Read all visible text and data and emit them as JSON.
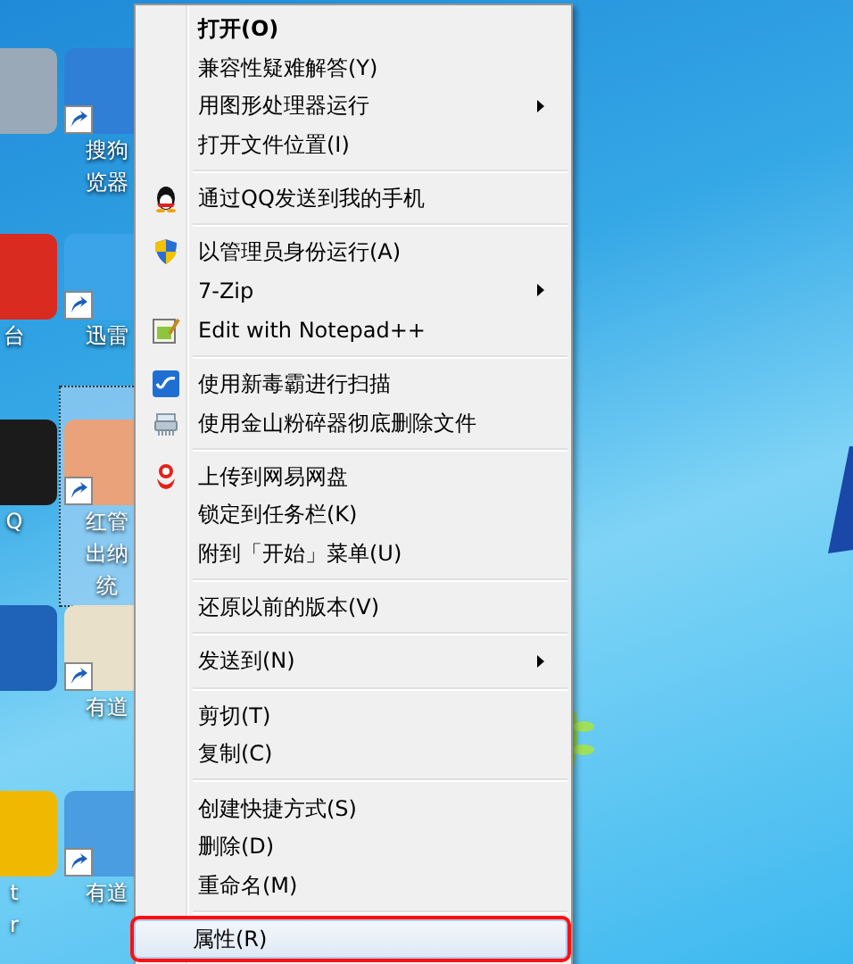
{
  "desktop": {
    "icons": [
      {
        "selected": false
      },
      {
        "lines": [
          "搜狗",
          "览器"
        ],
        "selected": false
      },
      {
        "lines": [
          "台"
        ],
        "selected": false
      },
      {
        "lines": [
          "迅雷"
        ],
        "selected": false
      },
      {
        "lines": [
          "Q"
        ],
        "selected": false
      },
      {
        "lines": [
          "红管",
          "出纳",
          "统"
        ],
        "selected": true
      },
      {
        "selected": false
      },
      {
        "lines": [
          "有道"
        ],
        "selected": false
      },
      {
        "lines": [
          "t",
          "r"
        ],
        "selected": false
      },
      {
        "lines": [
          "有道"
        ],
        "selected": false
      }
    ]
  },
  "context_menu": {
    "items": [
      {
        "kind": "item",
        "label": "打开(O)",
        "default": true,
        "submenu": false,
        "selected": false
      },
      {
        "kind": "item",
        "label": "兼容性疑难解答(Y)",
        "default": false,
        "submenu": false,
        "selected": false
      },
      {
        "kind": "item",
        "label": "用图形处理器运行",
        "default": false,
        "submenu": true,
        "selected": false
      },
      {
        "kind": "item",
        "label": "打开文件位置(I)",
        "default": false,
        "submenu": false,
        "selected": false
      },
      {
        "kind": "separator"
      },
      {
        "kind": "item",
        "label": "通过QQ发送到我的手机",
        "default": false,
        "submenu": false,
        "selected": false
      },
      {
        "kind": "separator"
      },
      {
        "kind": "item",
        "label": "以管理员身份运行(A)",
        "default": false,
        "submenu": false,
        "selected": false
      },
      {
        "kind": "item",
        "label": "7-Zip",
        "default": false,
        "submenu": true,
        "selected": false
      },
      {
        "kind": "item",
        "label": "Edit with Notepad++",
        "default": false,
        "submenu": false,
        "selected": false
      },
      {
        "kind": "separator"
      },
      {
        "kind": "item",
        "label": "使用新毒霸进行扫描",
        "default": false,
        "submenu": false,
        "selected": false
      },
      {
        "kind": "item",
        "label": "使用金山粉碎器彻底删除文件",
        "default": false,
        "submenu": false,
        "selected": false
      },
      {
        "kind": "separator"
      },
      {
        "kind": "item",
        "label": "上传到网易网盘",
        "default": false,
        "submenu": false,
        "selected": false
      },
      {
        "kind": "item",
        "label": "锁定到任务栏(K)",
        "default": false,
        "submenu": false,
        "selected": false
      },
      {
        "kind": "item",
        "label": "附到「开始」菜单(U)",
        "default": false,
        "submenu": false,
        "selected": false
      },
      {
        "kind": "separator"
      },
      {
        "kind": "item",
        "label": "还原以前的版本(V)",
        "default": false,
        "submenu": false,
        "selected": false
      },
      {
        "kind": "separator"
      },
      {
        "kind": "item",
        "label": "发送到(N)",
        "default": false,
        "submenu": true,
        "selected": false
      },
      {
        "kind": "separator"
      },
      {
        "kind": "item",
        "label": "剪切(T)",
        "default": false,
        "submenu": false,
        "selected": false
      },
      {
        "kind": "item",
        "label": "复制(C)",
        "default": false,
        "submenu": false,
        "selected": false
      },
      {
        "kind": "separator"
      },
      {
        "kind": "item",
        "label": "创建快捷方式(S)",
        "default": false,
        "submenu": false,
        "selected": false
      },
      {
        "kind": "item",
        "label": "删除(D)",
        "default": false,
        "submenu": false,
        "selected": false
      },
      {
        "kind": "item",
        "label": "重命名(M)",
        "default": false,
        "submenu": false,
        "selected": false
      },
      {
        "kind": "separator"
      },
      {
        "kind": "item",
        "label": "属性(R)",
        "default": false,
        "submenu": false,
        "selected": true
      }
    ]
  }
}
